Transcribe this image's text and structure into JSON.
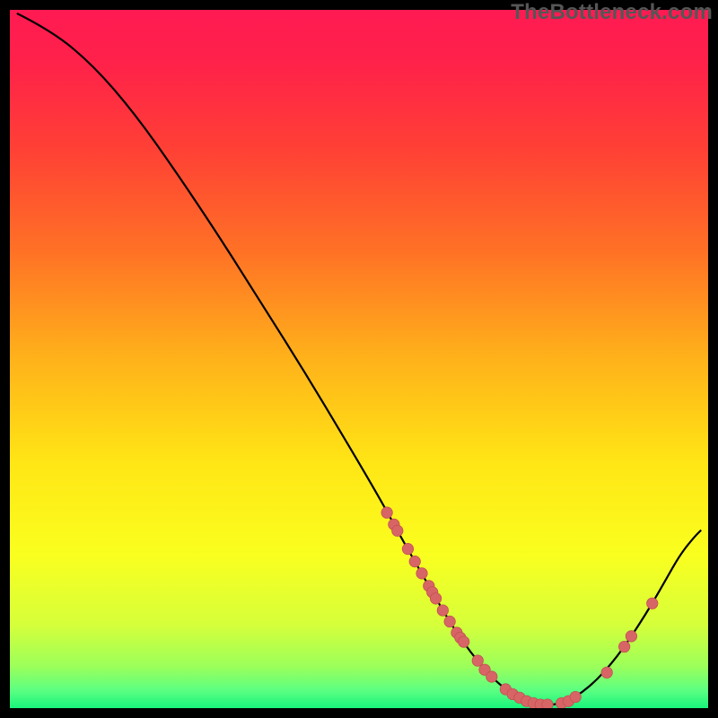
{
  "watermark": "TheBottleneck.com",
  "colors": {
    "bg": "#000000",
    "gradient_stops": [
      {
        "offset": 0.0,
        "color": "#ff1a52"
      },
      {
        "offset": 0.08,
        "color": "#ff2249"
      },
      {
        "offset": 0.2,
        "color": "#ff4035"
      },
      {
        "offset": 0.35,
        "color": "#ff7325"
      },
      {
        "offset": 0.5,
        "color": "#ffb21a"
      },
      {
        "offset": 0.65,
        "color": "#ffe615"
      },
      {
        "offset": 0.78,
        "color": "#faff1f"
      },
      {
        "offset": 0.88,
        "color": "#d6ff3a"
      },
      {
        "offset": 0.94,
        "color": "#9cff5a"
      },
      {
        "offset": 0.975,
        "color": "#5aff82"
      },
      {
        "offset": 1.0,
        "color": "#18f47c"
      }
    ],
    "curve": "#000000",
    "marker_fill": "#d86566",
    "marker_stroke": "#c24f52"
  },
  "chart_data": {
    "type": "line",
    "title": "",
    "xlabel": "",
    "ylabel": "",
    "xlim": [
      0,
      100
    ],
    "ylim": [
      0,
      100
    ],
    "curve": [
      {
        "x": 1.0,
        "y": 99.5
      },
      {
        "x": 6.0,
        "y": 97.0
      },
      {
        "x": 12.0,
        "y": 92.0
      },
      {
        "x": 18.0,
        "y": 85.0
      },
      {
        "x": 24.0,
        "y": 76.5
      },
      {
        "x": 30.0,
        "y": 67.5
      },
      {
        "x": 36.0,
        "y": 58.0
      },
      {
        "x": 42.0,
        "y": 48.5
      },
      {
        "x": 48.0,
        "y": 38.5
      },
      {
        "x": 53.0,
        "y": 30.0
      },
      {
        "x": 56.0,
        "y": 24.5
      },
      {
        "x": 58.0,
        "y": 21.0
      },
      {
        "x": 60.0,
        "y": 17.5
      },
      {
        "x": 62.0,
        "y": 14.0
      },
      {
        "x": 64.0,
        "y": 10.8
      },
      {
        "x": 66.0,
        "y": 8.0
      },
      {
        "x": 68.0,
        "y": 5.5
      },
      {
        "x": 70.0,
        "y": 3.5
      },
      {
        "x": 72.0,
        "y": 2.0
      },
      {
        "x": 74.0,
        "y": 1.0
      },
      {
        "x": 76.0,
        "y": 0.5
      },
      {
        "x": 78.0,
        "y": 0.5
      },
      {
        "x": 80.0,
        "y": 1.0
      },
      {
        "x": 82.0,
        "y": 2.3
      },
      {
        "x": 84.0,
        "y": 4.0
      },
      {
        "x": 86.0,
        "y": 6.2
      },
      {
        "x": 88.0,
        "y": 8.8
      },
      {
        "x": 90.0,
        "y": 11.8
      },
      {
        "x": 92.0,
        "y": 15.0
      },
      {
        "x": 94.0,
        "y": 18.5
      },
      {
        "x": 96.0,
        "y": 22.0
      },
      {
        "x": 98.0,
        "y": 24.5
      },
      {
        "x": 99.0,
        "y": 25.5
      }
    ],
    "markers": [
      {
        "x": 54.0,
        "y": 28.0
      },
      {
        "x": 55.0,
        "y": 26.3
      },
      {
        "x": 55.5,
        "y": 25.4
      },
      {
        "x": 57.0,
        "y": 22.8
      },
      {
        "x": 58.0,
        "y": 21.0
      },
      {
        "x": 59.0,
        "y": 19.3
      },
      {
        "x": 60.0,
        "y": 17.5
      },
      {
        "x": 60.5,
        "y": 16.6
      },
      {
        "x": 61.0,
        "y": 15.7
      },
      {
        "x": 62.0,
        "y": 14.0
      },
      {
        "x": 63.0,
        "y": 12.4
      },
      {
        "x": 64.0,
        "y": 10.8
      },
      {
        "x": 64.5,
        "y": 10.1
      },
      {
        "x": 65.0,
        "y": 9.5
      },
      {
        "x": 67.0,
        "y": 6.8
      },
      {
        "x": 68.0,
        "y": 5.5
      },
      {
        "x": 69.0,
        "y": 4.5
      },
      {
        "x": 71.0,
        "y": 2.7
      },
      {
        "x": 72.0,
        "y": 2.0
      },
      {
        "x": 73.0,
        "y": 1.5
      },
      {
        "x": 74.0,
        "y": 1.0
      },
      {
        "x": 75.0,
        "y": 0.7
      },
      {
        "x": 76.0,
        "y": 0.5
      },
      {
        "x": 77.0,
        "y": 0.5
      },
      {
        "x": 79.0,
        "y": 0.7
      },
      {
        "x": 80.0,
        "y": 1.0
      },
      {
        "x": 81.0,
        "y": 1.6
      },
      {
        "x": 85.5,
        "y": 5.1
      },
      {
        "x": 88.0,
        "y": 8.8
      },
      {
        "x": 89.0,
        "y": 10.3
      },
      {
        "x": 92.0,
        "y": 15.0
      }
    ]
  }
}
